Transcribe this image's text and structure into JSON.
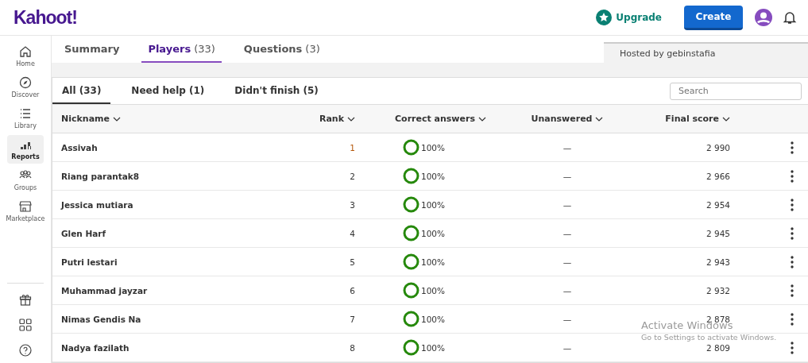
{
  "header": {
    "logo": "Kahoot!",
    "upgrade": "Upgrade",
    "create": "Create"
  },
  "sidebar": {
    "items": [
      {
        "label": "Home",
        "selected": false
      },
      {
        "label": "Discover",
        "selected": false
      },
      {
        "label": "Library",
        "selected": false
      },
      {
        "label": "Reports",
        "selected": true
      },
      {
        "label": "Groups",
        "selected": false
      },
      {
        "label": "Marketplace",
        "selected": false
      }
    ]
  },
  "report_tabs": [
    {
      "label": "Summary",
      "selected": false
    },
    {
      "label": "Players",
      "count": "(33)",
      "selected": true
    },
    {
      "label": "Questions",
      "count": "(3)",
      "selected": false
    }
  ],
  "hosted_by": "Hosted by gebinstafia",
  "filters": [
    {
      "label": "All (33)",
      "selected": true
    },
    {
      "label": "Need help (1)",
      "selected": false
    },
    {
      "label": "Didn't finish (5)",
      "selected": false
    }
  ],
  "search": {
    "placeholder": "Search"
  },
  "table": {
    "columns": [
      "Nickname",
      "Rank",
      "Correct answers",
      "Unanswered",
      "Final score"
    ],
    "rows": [
      {
        "nickname": "Assivah",
        "rank": "1",
        "correct": "100%",
        "unanswered": "—",
        "score": "2 990"
      },
      {
        "nickname": "Riang parantak8",
        "rank": "2",
        "correct": "100%",
        "unanswered": "—",
        "score": "2 966"
      },
      {
        "nickname": "Jessica mutiara",
        "rank": "3",
        "correct": "100%",
        "unanswered": "—",
        "score": "2 954"
      },
      {
        "nickname": "Glen Harf",
        "rank": "4",
        "correct": "100%",
        "unanswered": "—",
        "score": "2 945"
      },
      {
        "nickname": "Putri lestari",
        "rank": "5",
        "correct": "100%",
        "unanswered": "—",
        "score": "2 943"
      },
      {
        "nickname": "Muhammad jayzar",
        "rank": "6",
        "correct": "100%",
        "unanswered": "—",
        "score": "2 932"
      },
      {
        "nickname": "Nimas Gendis Na",
        "rank": "7",
        "correct": "100%",
        "unanswered": "—",
        "score": "2 878"
      },
      {
        "nickname": "Nadya fazilath",
        "rank": "8",
        "correct": "100%",
        "unanswered": "—",
        "score": "2 809"
      }
    ]
  },
  "os_notice": {
    "title": "Activate Windows",
    "subtitle": "Go to Settings to activate Windows."
  }
}
